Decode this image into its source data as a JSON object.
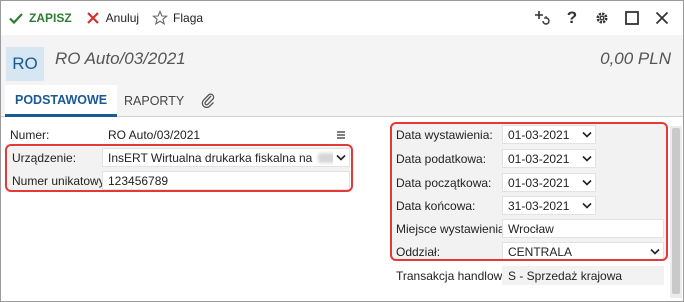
{
  "toolbar": {
    "save_label": "ZAPISZ",
    "cancel_label": "Anuluj",
    "flag_label": "Flaga",
    "right_icons": [
      "add-link-icon",
      "help-icon",
      "settings-icon",
      "maximize-icon",
      "close-icon"
    ],
    "help_glyph": "?"
  },
  "header": {
    "badge": "RO",
    "title": "RO Auto/03/2021",
    "total": "0,00 PLN"
  },
  "tabs": {
    "main": "PODSTAWOWE",
    "reports": "RAPORTY",
    "attach_icon": "paperclip-icon"
  },
  "form_left": {
    "number_label": "Numer:",
    "number_value": "RO Auto/03/2021",
    "device_label": "Urządzenie:",
    "device_value": "InsERT Wirtualna drukarka fiskalna na",
    "unique_label": "Numer unikatowy:",
    "unique_value": "123456789"
  },
  "form_right": {
    "issue_date_label": "Data wystawienia:",
    "issue_date_value": "01-03-2021",
    "tax_date_label": "Data podatkowa:",
    "tax_date_value": "01-03-2021",
    "start_date_label": "Data początkowa:",
    "start_date_value": "01-03-2021",
    "end_date_label": "Data końcowa:",
    "end_date_value": "31-03-2021",
    "place_label": "Miejsce wystawienia:",
    "place_value": "Wrocław",
    "branch_label": "Oddział:",
    "branch_value": "CENTRALA",
    "transaction_label": "Transakcja handlowa:",
    "transaction_value": "S - Sprzedaż krajowa"
  },
  "colors": {
    "accent": "#1a5a94",
    "save": "#2e7d32",
    "cancel": "#d32f2f",
    "highlight": "#e53935"
  }
}
